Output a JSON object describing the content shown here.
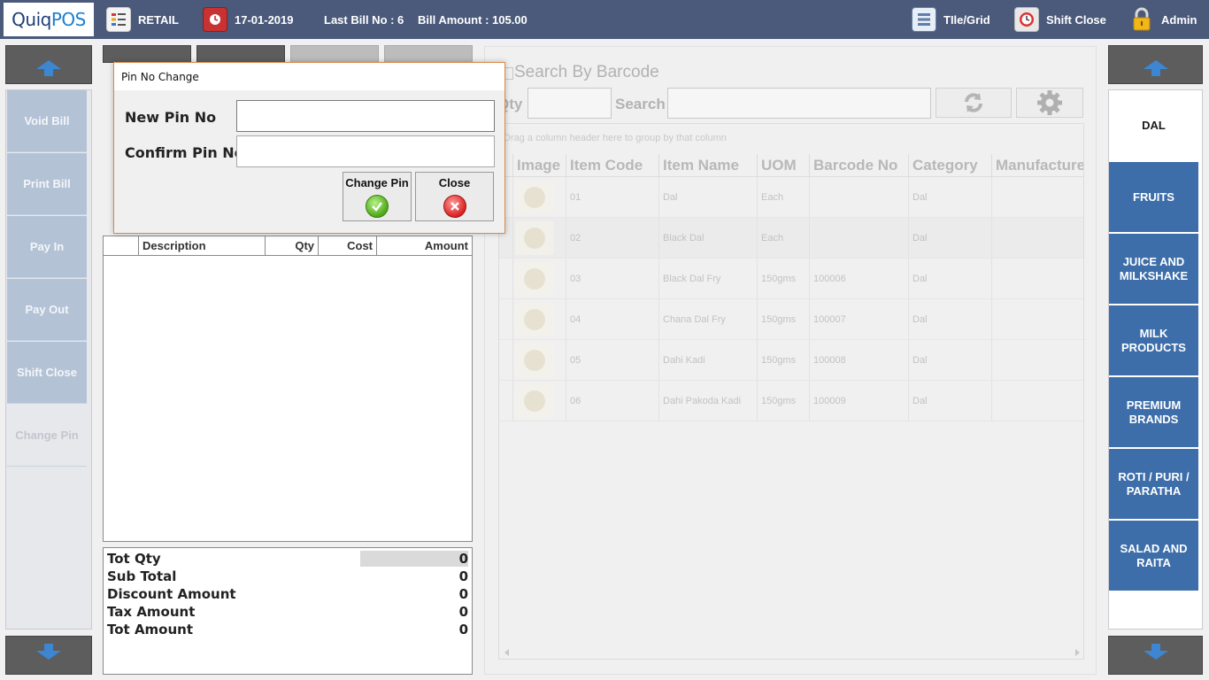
{
  "topbar": {
    "logo_a": "Quiq",
    "logo_b": "POS",
    "mode": "RETAIL",
    "date": "17-01-2019",
    "last_bill": "Last Bill No : 6",
    "bill_amount": "Bill Amount : 105.00",
    "tile_grid": "TIle/Grid",
    "shift_close": "Shift Close",
    "user": "Admin"
  },
  "left_actions": [
    "Void Bill",
    "Print Bill",
    "Pay In",
    "Pay Out",
    "Shift Close",
    "Change Pin"
  ],
  "bill": {
    "columns": [
      "Description",
      "Qty",
      "Cost",
      "Amount"
    ]
  },
  "totals": [
    {
      "label": "Tot Qty",
      "value": "0"
    },
    {
      "label": "Sub Total",
      "value": "0"
    },
    {
      "label": "Discount Amount",
      "value": "0"
    },
    {
      "label": "Tax Amount",
      "value": "0"
    },
    {
      "label": "Tot Amount",
      "value": "0"
    }
  ],
  "search": {
    "title": "Search By Barcode",
    "qty_label": "Qty",
    "search_label": "Search"
  },
  "grid": {
    "group_hint": "Drag a column header here to group by that column",
    "columns": [
      "Image",
      "Item Code",
      "Item Name",
      "UOM",
      "Barcode No",
      "Category",
      "Manufacture"
    ],
    "rows": [
      {
        "code": "01",
        "name": "Dal",
        "uom": "Each",
        "barcode": "",
        "category": "Dal"
      },
      {
        "code": "02",
        "name": "Black Dal",
        "uom": "Each",
        "barcode": "",
        "category": "Dal"
      },
      {
        "code": "03",
        "name": "Black Dal Fry",
        "uom": "150gms",
        "barcode": "100006",
        "category": "Dal"
      },
      {
        "code": "04",
        "name": "Chana Dal Fry",
        "uom": "150gms",
        "barcode": "100007",
        "category": "Dal"
      },
      {
        "code": "05",
        "name": "Dahi Kadi",
        "uom": "150gms",
        "barcode": "100008",
        "category": "Dal"
      },
      {
        "code": "06",
        "name": "Dahi Pakoda Kadi",
        "uom": "150gms",
        "barcode": "100009",
        "category": "Dal"
      }
    ]
  },
  "categories": [
    "DAL",
    "FRUITS",
    "JUICE AND MILKSHAKE",
    "MILK PRODUCTS",
    "PREMIUM BRANDS",
    "ROTI / PURI / PARATHA",
    "SALAD AND RAITA"
  ],
  "dialog": {
    "title": "Pin No Change",
    "new_pin_label": "New Pin No",
    "confirm_pin_label": "Confirm Pin No",
    "new_pin_value": "",
    "confirm_pin_value": "",
    "change_btn": "Change Pin",
    "close_btn": "Close"
  },
  "colors": {
    "topbar": "#4b5a7b",
    "category": "#3d6ea9",
    "left_action": "#b4c2d6",
    "dialog_border": "#d98a4a"
  }
}
